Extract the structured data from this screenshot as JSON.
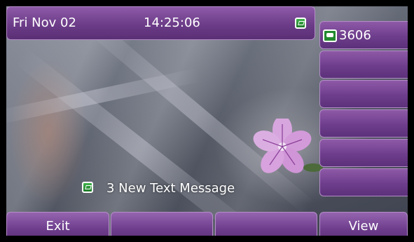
{
  "status_bar": {
    "date": "Fri Nov 02",
    "time": "14:25:06",
    "icon": "message-icon"
  },
  "line_keys": [
    {
      "label": "3606",
      "icon": "phone-icon"
    },
    {
      "label": ""
    },
    {
      "label": ""
    },
    {
      "label": ""
    },
    {
      "label": ""
    },
    {
      "label": ""
    }
  ],
  "notification": {
    "icon": "message-icon",
    "text": "3 New Text Message"
  },
  "softkeys": [
    "Exit",
    "",
    "",
    "View"
  ],
  "colors": {
    "accent": "#7a4a96",
    "message_icon": "#2f9a3a"
  }
}
